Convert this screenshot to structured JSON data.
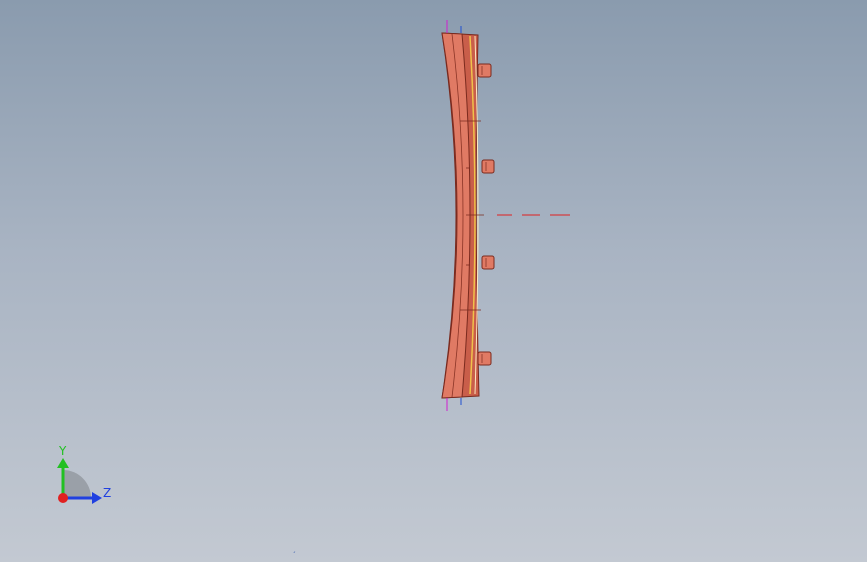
{
  "viewport": {
    "background_top": "#8a9bae",
    "background_bottom": "#c3c9d2"
  },
  "model": {
    "part_color": "#d9745f",
    "part_edge_color": "#7a2a1e",
    "highlight_color": "#f0c24a",
    "sketch_color": "#e02020",
    "origin_color_magenta": "#d020d0",
    "origin_color_blue": "#2050d0"
  },
  "triad": {
    "y_label": "Y",
    "z_label": "Z",
    "y_color": "#22c022",
    "z_color": "#2040e0",
    "x_color": "#e02020",
    "icon": "view-orientation-triad-icon"
  },
  "stray_mark": "ˏ"
}
